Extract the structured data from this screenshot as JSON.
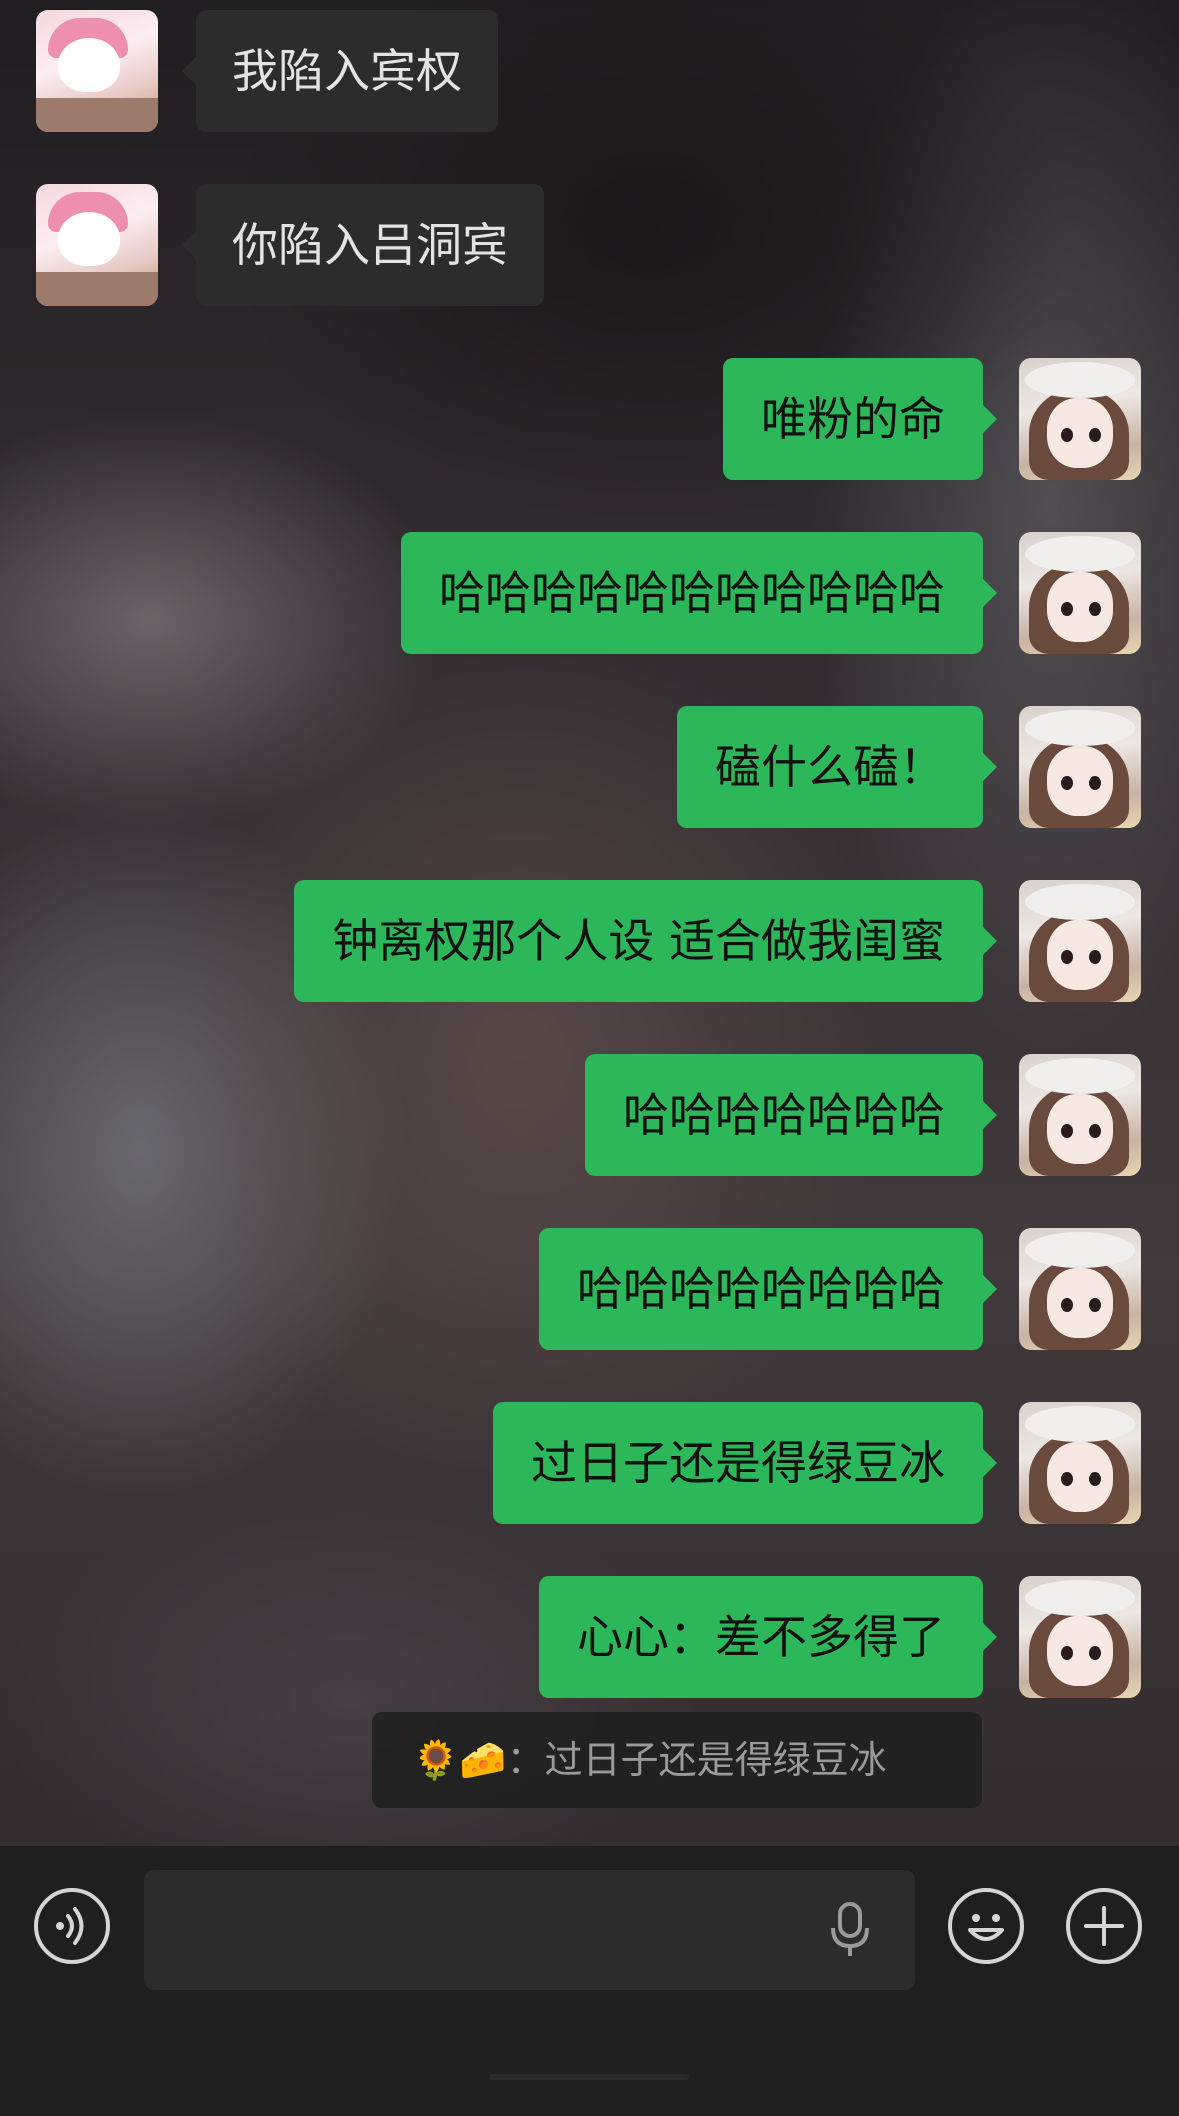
{
  "messages": [
    {
      "side": "peer",
      "text": "我陷入宾权"
    },
    {
      "side": "peer",
      "text": "你陷入吕洞宾"
    },
    {
      "side": "self",
      "text": "唯粉的命"
    },
    {
      "side": "self",
      "text": "哈哈哈哈哈哈哈哈哈哈哈"
    },
    {
      "side": "self",
      "text": "磕什么磕！"
    },
    {
      "side": "self",
      "text": "钟离权那个人设 适合做我闺蜜"
    },
    {
      "side": "self",
      "text": "哈哈哈哈哈哈哈"
    },
    {
      "side": "self",
      "text": "哈哈哈哈哈哈哈哈"
    },
    {
      "side": "self",
      "text": "过日子还是得绿豆冰"
    },
    {
      "side": "self",
      "text": "心心：差不多得了"
    }
  ],
  "quote": {
    "emoji": "🌻🧀",
    "text": "：过日子还是得绿豆冰"
  },
  "input_bar": {
    "voice_icon": "voice-wave-icon",
    "mic_icon": "microphone-icon",
    "emoji_icon": "smiley-icon",
    "plus_icon": "plus-icon",
    "placeholder": ""
  },
  "colors": {
    "self_bubble": "#2bb75a",
    "peer_bubble": "#2c2c2c",
    "input_bar": "#1f1f1f"
  }
}
